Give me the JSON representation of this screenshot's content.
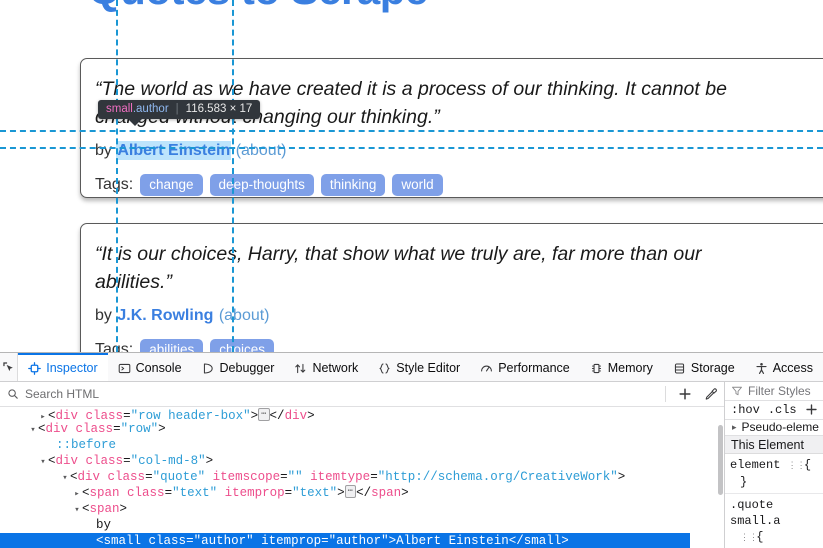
{
  "webpage": {
    "site_title": "Quotes to Scrape",
    "title_color": "#3a7fe0",
    "tags_label": "Tags:",
    "by_label": "by",
    "about_label": "(about)",
    "quotes": [
      {
        "text": "“The world as we have created it is a process of our thinking. It cannot be changed without changing our thinking.”",
        "author": "Albert Einstein",
        "tags": [
          "change",
          "deep-thoughts",
          "thinking",
          "world"
        ]
      },
      {
        "text": "“It is our choices, Harry, that show what we truly are, far more than our abilities.”",
        "author": "J.K. Rowling",
        "tags": [
          "abilities",
          "choices"
        ]
      }
    ]
  },
  "highlighter": {
    "infobar": {
      "tag": "small",
      "classes": ".author",
      "separator": "|",
      "dimensions": "116.583 × 17"
    },
    "guide_color": "#1a97d4"
  },
  "devtools": {
    "tabs": [
      {
        "label": "Inspector",
        "icon": "inspector-icon",
        "active": true
      },
      {
        "label": "Console",
        "icon": "console-icon",
        "active": false
      },
      {
        "label": "Debugger",
        "icon": "debugger-icon",
        "active": false
      },
      {
        "label": "Network",
        "icon": "network-icon",
        "active": false
      },
      {
        "label": "Style Editor",
        "icon": "style-editor-icon",
        "active": false
      },
      {
        "label": "Performance",
        "icon": "performance-icon",
        "active": false
      },
      {
        "label": "Memory",
        "icon": "memory-icon",
        "active": false
      },
      {
        "label": "Storage",
        "icon": "storage-icon",
        "active": false
      },
      {
        "label": "Access",
        "icon": "accessibility-icon",
        "active": false
      }
    ],
    "picker_icon": "element-picker-icon",
    "search": {
      "placeholder": "Search HTML",
      "icon": "search-icon",
      "add_node_icon": "plus-icon",
      "eyedropper_icon": "eyedropper-icon"
    },
    "markup": {
      "rows": [
        {
          "indent": 2,
          "twisty": "▸",
          "content_type": "element_collapsed",
          "tag": "div",
          "attr_name": "class",
          "attr_value": "\"row header-box\"",
          "clipped": true
        },
        {
          "indent": 1,
          "twisty": "▾",
          "content_type": "element_open",
          "tag": "div",
          "attr_name": "class",
          "attr_value": "\"row\""
        },
        {
          "indent": 3,
          "twisty": "",
          "content_type": "pseudo",
          "text": "::before"
        },
        {
          "indent": 2,
          "twisty": "▾",
          "content_type": "element_open",
          "tag": "div",
          "attr_name": "class",
          "attr_value": "\"col-md-8\""
        },
        {
          "indent": 3,
          "twisty": "▾",
          "content_type": "element_open_multi",
          "tag": "div",
          "attrs": [
            [
              "class",
              "\"quote\""
            ],
            [
              "itemscope",
              "\"\""
            ],
            [
              "itemtype",
              "\"http://schema.org/CreativeWork\""
            ]
          ]
        },
        {
          "indent": 4,
          "twisty": "▸",
          "content_type": "span_collapsed",
          "tag": "span",
          "attrs": [
            [
              "class",
              "\"text\""
            ],
            [
              "itemprop",
              "\"text\""
            ]
          ]
        },
        {
          "indent": 4,
          "twisty": "▾",
          "content_type": "span_open",
          "tag": "span"
        },
        {
          "indent": 6,
          "twisty": "",
          "content_type": "text",
          "text": "by"
        },
        {
          "indent": 5,
          "twisty": "",
          "content_type": "selected",
          "tag": "small",
          "attrs": [
            [
              "class",
              "\"author\""
            ],
            [
              "itemprop",
              "\"author\""
            ]
          ],
          "inner_text": "Albert Einstein",
          "selected": true
        }
      ],
      "selected_row_bg": "#0a74e6"
    },
    "styles_panel": {
      "filter_placeholder": "Filter Styles",
      "filter_icon": "filter-icon",
      "hov_label": ":hov",
      "cls_label": ".cls",
      "add_rule_icon": "plus-icon",
      "print_icon": "print-styles-icon",
      "pseudo_elements_label": "Pseudo-eleme",
      "pseudo_twisty": "▸",
      "this_element_label": "This Element",
      "rules": [
        {
          "selector": "element",
          "has_dots": true,
          "open_brace": "{",
          "close_brace": "}"
        },
        {
          "selector": ".quote small.a",
          "has_dots": true,
          "open_brace": "{",
          "close_brace": ""
        }
      ]
    }
  }
}
